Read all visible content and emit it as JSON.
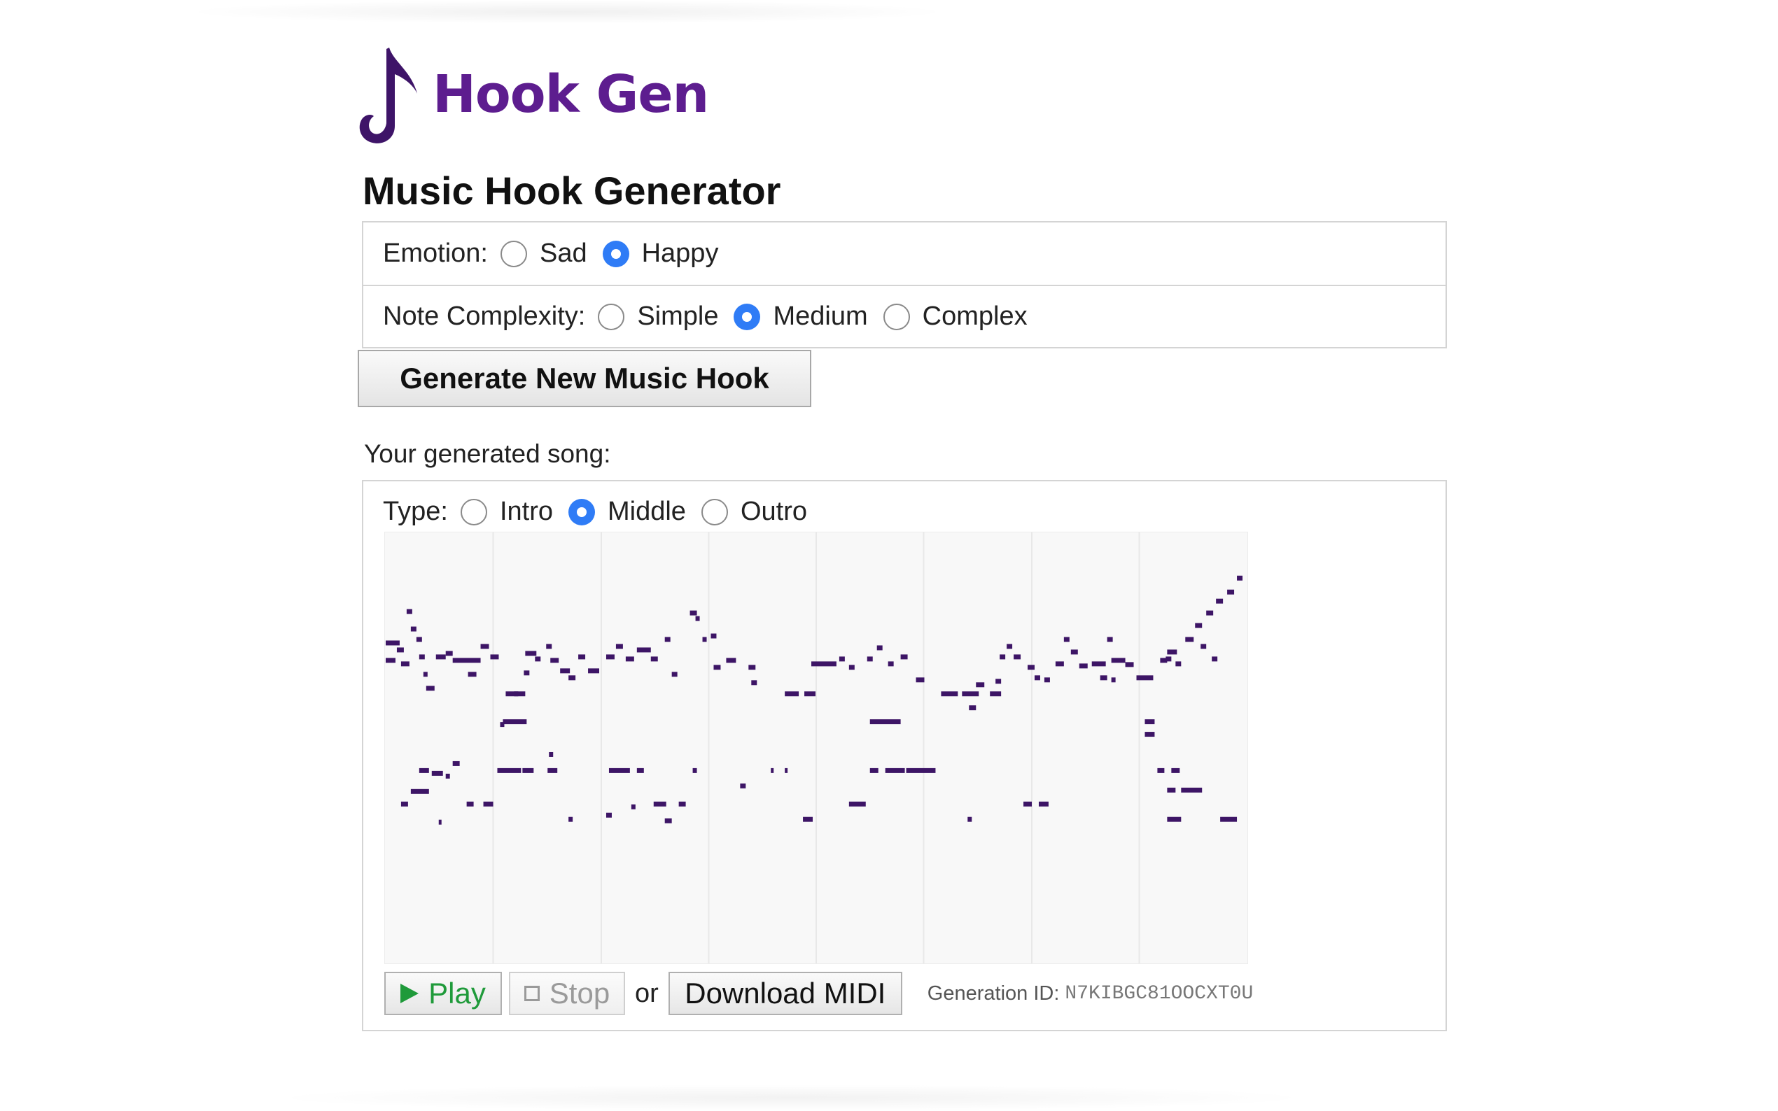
{
  "brand": {
    "logo_text": "Hook Gen",
    "logo_icon": "music-note-icon",
    "color": "#5d1d8f"
  },
  "title": "Music Hook Generator",
  "emotion": {
    "label": "Emotion:",
    "options": [
      {
        "label": "Sad",
        "checked": false
      },
      {
        "label": "Happy",
        "checked": true
      }
    ]
  },
  "complexity": {
    "label": "Note Complexity:",
    "options": [
      {
        "label": "Simple",
        "checked": false
      },
      {
        "label": "Medium",
        "checked": true
      },
      {
        "label": "Complex",
        "checked": false
      }
    ]
  },
  "generate_label": "Generate New Music Hook",
  "song": {
    "label": "Your generated song:",
    "type_label": "Type:",
    "type_options": [
      {
        "label": "Intro",
        "checked": false
      },
      {
        "label": "Middle",
        "checked": true
      },
      {
        "label": "Outro",
        "checked": false
      }
    ]
  },
  "controls": {
    "play_label": "Play",
    "stop_label": "Stop",
    "or_label": "or",
    "download_label": "Download MIDI",
    "generation_id_label": "Generation ID:",
    "generation_id": "N7KIBGC81OOCXT0U"
  },
  "colors": {
    "accent_radio": "#2f7cf6",
    "note": "#3d1566",
    "play": "#1f9a3a"
  }
}
